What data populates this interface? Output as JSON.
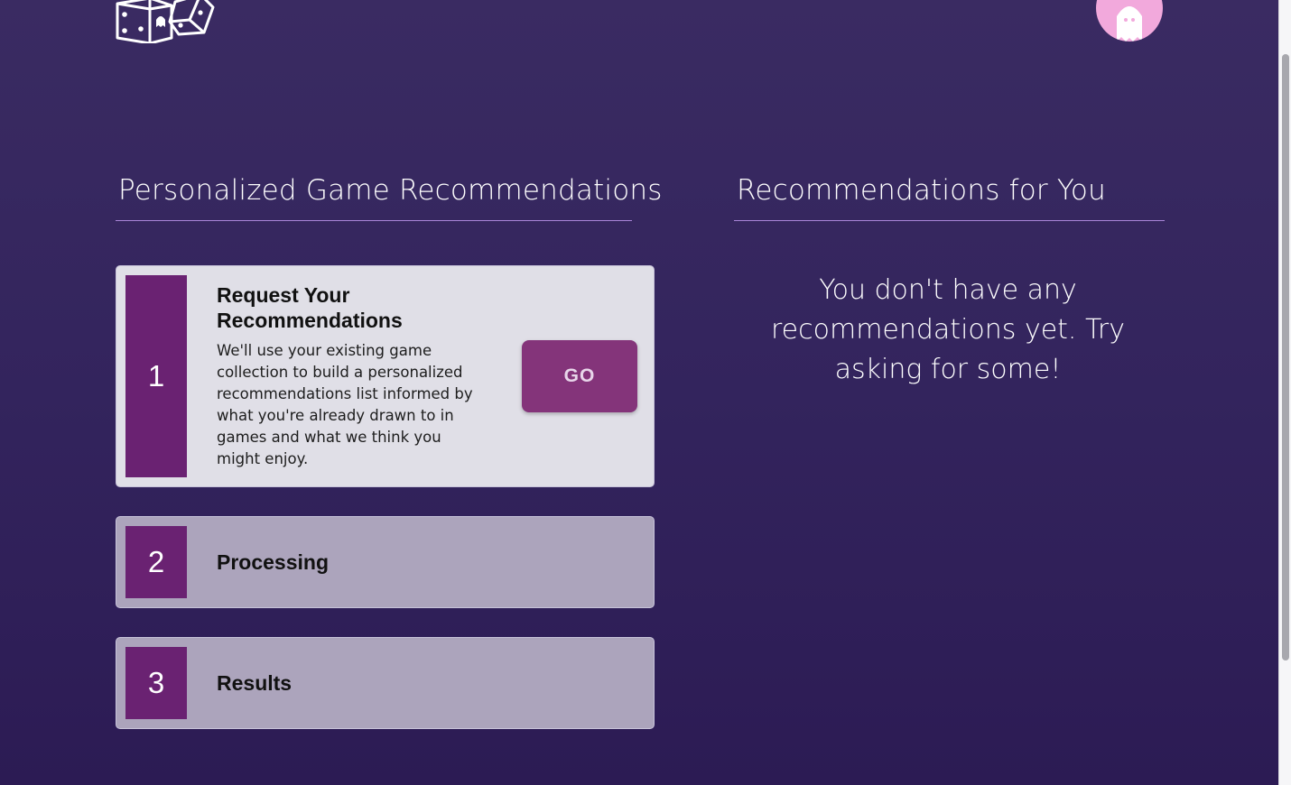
{
  "header": {
    "logo_icon": "dice-icon",
    "avatar_icon": "ghost-icon",
    "avatar_color": "#f2a9dc"
  },
  "left_section": {
    "title": "Personalized Game Recommendations",
    "steps": [
      {
        "number": "1",
        "title": "Request Your Recommendations",
        "description": "We'll use your existing game collection to build a personalized recommendations list informed by what you're already drawn to in games and what we think you might enjoy.",
        "button_label": "GO",
        "state": "active"
      },
      {
        "number": "2",
        "title": "Processing",
        "state": "inactive"
      },
      {
        "number": "3",
        "title": "Results",
        "state": "inactive"
      }
    ]
  },
  "right_section": {
    "title": "Recommendations for You",
    "empty_message": "You don't have any recommendations yet. Try asking for some!"
  },
  "colors": {
    "background_top": "#3a2b62",
    "background_bottom": "#2c1b54",
    "accent_purple": "#6a2272",
    "button": "#84347a",
    "rule": "#a985d8"
  }
}
